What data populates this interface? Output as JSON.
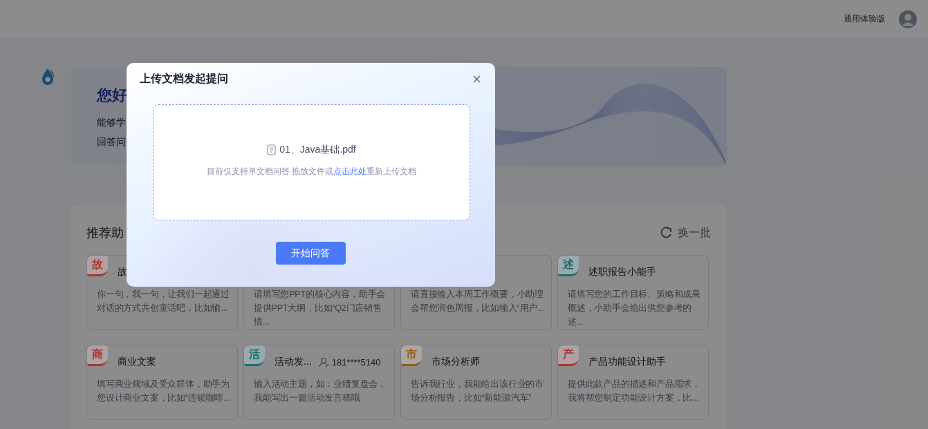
{
  "header": {
    "edition": "通用体验版"
  },
  "hero": {
    "greeting": "您好",
    "lines": [
      "能够学",
      "回答问"
    ]
  },
  "assistants": {
    "title": "推荐助",
    "refresh": "换一批",
    "cards": [
      {
        "badge": "故",
        "color": "#a8362f",
        "title": "故",
        "description": "你一句，我一句，让我们一起通过对话的方式共创童话吧，比如输..."
      },
      {
        "description": "请填写您PPT的核心内容，助手会提供PPT大纲，比如“Q2门店销售情..."
      },
      {
        "description": "请直接输入本周工作概要，小助理会帮您润色周报，比如输入“用户..."
      },
      {
        "badge": "述",
        "color": "#17706b",
        "title": "述职报告小能手",
        "description": "请填写您的工作目标、策略和成果概述，小助手会给出供您参考的述..."
      },
      {
        "badge": "商",
        "color": "#a8362f",
        "title": "商业文案",
        "description": "填写商业领域及受众群体，助手为您设计商业文案，比如“连锁咖啡..."
      },
      {
        "badge": "活",
        "color": "#17706b",
        "title": "活动发...",
        "author": "181****5140",
        "description": "输入活动主题，如：业绩复盘会，我能写出一篇活动发言稿哦"
      },
      {
        "badge": "市",
        "color": "#955a12",
        "title": "市场分析师",
        "description": "告诉我行业，我能给出该行业的市场分析报告，比如“新能源汽车”"
      },
      {
        "badge": "产",
        "color": "#a8362f",
        "title": "产品功能设计助手",
        "description": "提供此款产品的描述和产品需求，我将帮您制定功能设计方案，比..."
      }
    ]
  },
  "dialog": {
    "title": "上传文档发起提问",
    "file": "01、Java基础.pdf",
    "hint": "目前仅支持单文档问答 拖放文件或",
    "hint_link": "点击此处",
    "hint_end": "重新上传文档",
    "button": "开始问答"
  }
}
